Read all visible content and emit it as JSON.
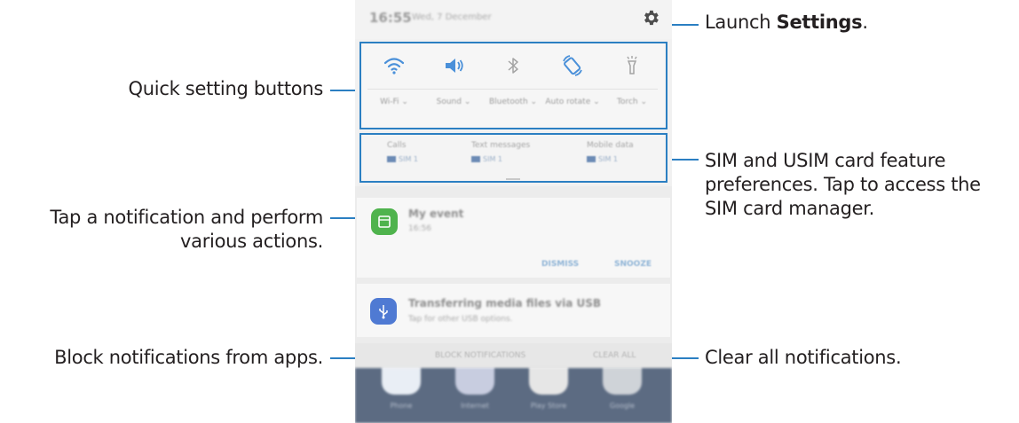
{
  "callouts": {
    "settings_prefix": "Launch ",
    "settings_bold": "Settings",
    "settings_suffix": ".",
    "quick_settings": "Quick setting buttons",
    "sim_line1": "SIM and USIM card feature",
    "sim_line2": "preferences. Tap to access the",
    "sim_line3": "SIM card manager.",
    "notif_line1": "Tap a notification and perform",
    "notif_line2": "various actions.",
    "block": "Block notifications from apps.",
    "clear": "Clear all notifications."
  },
  "status_bar": {
    "time": "16:55",
    "date": "Wed, 7 December",
    "settings_icon": "gear-icon"
  },
  "quick_settings": [
    {
      "label": "Wi-Fi ⌄",
      "icon": "wifi-icon"
    },
    {
      "label": "Sound ⌄",
      "icon": "sound-icon"
    },
    {
      "label": "Bluetooth ⌄",
      "icon": "bluetooth-icon"
    },
    {
      "label": "Auto rotate ⌄",
      "icon": "auto-rotate-icon"
    },
    {
      "label": "Torch ⌄",
      "icon": "torch-icon"
    }
  ],
  "sim_preferences": [
    {
      "title": "Calls",
      "value": "SIM 1"
    },
    {
      "title": "Text messages",
      "value": "SIM 1"
    },
    {
      "title": "Mobile data",
      "value": "SIM 1"
    }
  ],
  "notifications": [
    {
      "title": "My event",
      "subtitle": "16:56",
      "icon": "calendar-icon",
      "actions": [
        "DISMISS",
        "SNOOZE"
      ]
    },
    {
      "title": "Transferring media files via USB",
      "subtitle": "Tap for other USB options.",
      "icon": "usb-icon"
    }
  ],
  "bottom_bar": {
    "block": "BLOCK NOTIFICATIONS",
    "clear": "CLEAR ALL"
  },
  "home_apps": [
    "Phone",
    "Internet",
    "Play Store",
    "Google"
  ],
  "colors": {
    "leader": "#2b7fc2",
    "calendar": "#4fb34d",
    "usb": "#4f7ad3"
  }
}
